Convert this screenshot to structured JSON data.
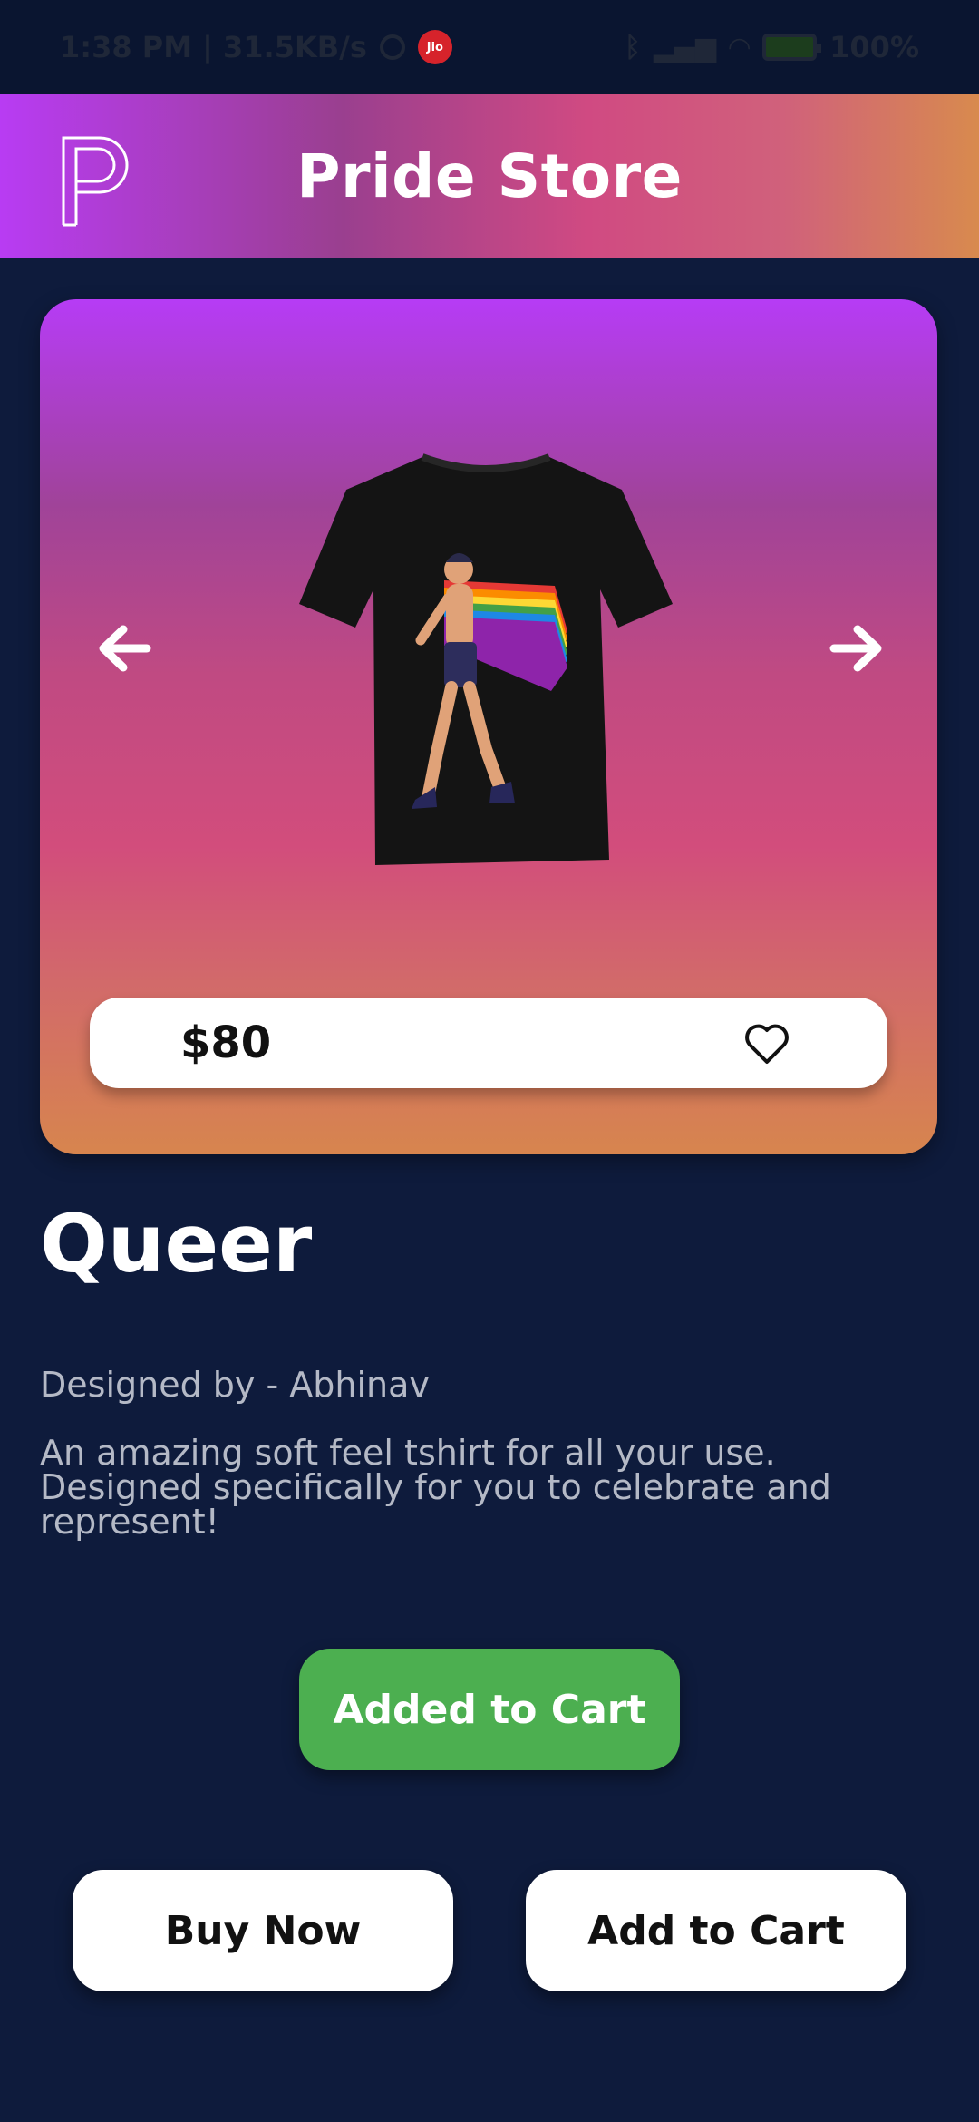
{
  "status_bar": {
    "time_speed": "1:38 PM | 31.5KB/s",
    "carrier_badge": "Jio",
    "battery": "100%"
  },
  "header": {
    "title": "Pride Store",
    "logo_icon": "p-logo-icon"
  },
  "product": {
    "price": "$80",
    "name": "Queer",
    "designer": "Designed by - Abhinav",
    "description": "An amazing soft feel tshirt for all your use. Designed specifically for you to celebrate and represent!",
    "image_icon": "pride-tshirt-image",
    "favorite_icon": "heart-outline-icon",
    "prev_icon": "arrow-left-icon",
    "next_icon": "arrow-right-icon"
  },
  "actions": {
    "added_to_cart": "Added to Cart",
    "buy_now": "Buy Now",
    "add_to_cart": "Add to Cart"
  },
  "colors": {
    "background": "#0e1b3c",
    "added_button": "#4caf50",
    "header_gradient_start": "#b83cf3",
    "header_gradient_end": "#d88a4e"
  }
}
